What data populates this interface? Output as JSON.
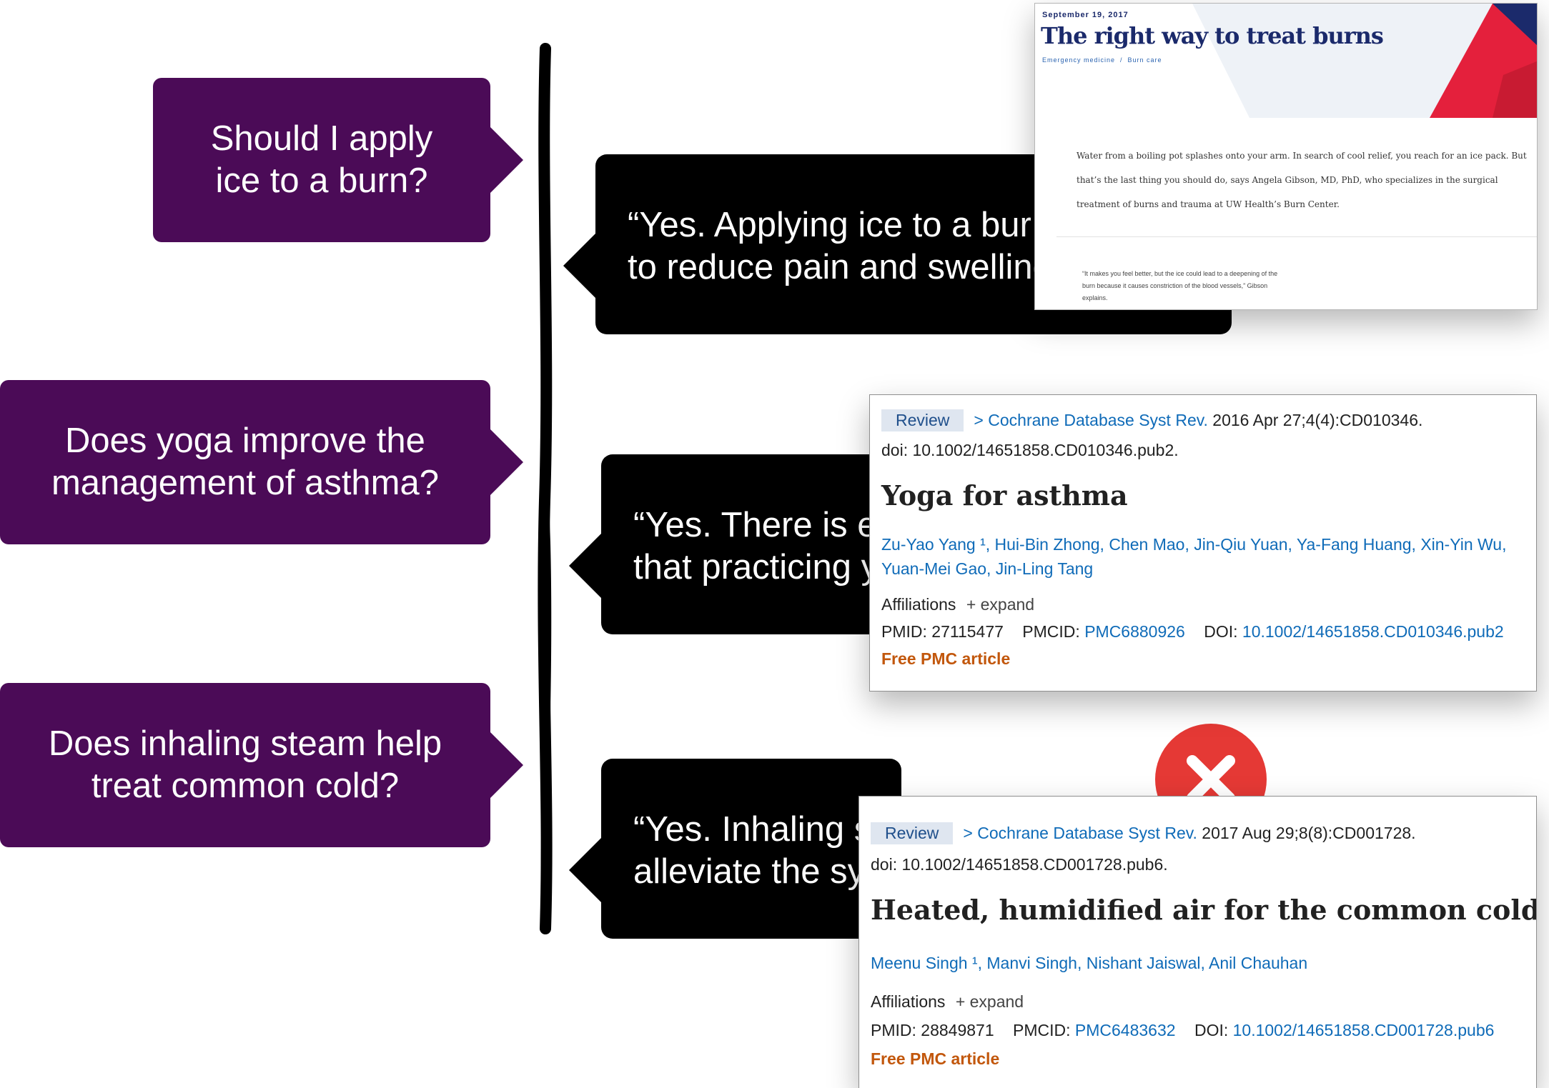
{
  "questions": [
    {
      "text": "Should I apply\nice to a burn?"
    },
    {
      "text": "Does yoga improve the\nmanagement of asthma?"
    },
    {
      "text": "Does inhaling steam help\ntreat common cold?"
    }
  ],
  "answers": [
    {
      "text": "“Yes. Applying ice to a bur\nto reduce pain and swelling"
    },
    {
      "text": "“Yes. There is e\nthat practicing y"
    },
    {
      "text": "“Yes. Inhaling s\nalleviate the sy"
    }
  ],
  "burn_article": {
    "date": "September 19, 2017",
    "title": "The right way to treat burns",
    "tags": "Emergency medicine  /  Burn care",
    "body_lines": [
      "Water from a boiling pot splashes onto your arm. In search of cool relief, you reach for an ice pack. But",
      "that’s the last thing you should do, says Angela Gibson, MD, PhD, who specializes in the surgical",
      "treatment of burns and trauma at UW Health’s Burn Center."
    ],
    "quote_lines": [
      "“It makes you feel better, but the ice could lead to a deepening of the",
      "burn because it causes constriction of the blood vessels,” Gibson",
      "explains."
    ]
  },
  "pubmed_cards": [
    {
      "tag": "Review",
      "journal": "Cochrane Database Syst Rev.",
      "citation": " 2016 Apr 27;4(4):CD010346.",
      "doi_line": "doi: 10.1002/14651858.CD010346.pub2.",
      "title": "Yoga for asthma",
      "authors_line1": "Zu-Yao Yang ¹, Hui-Bin Zhong, Chen Mao, Jin-Qiu Yuan, Ya-Fang Huang, Xin-Yin Wu,",
      "authors_line2": "Yuan-Mei Gao, Jin-Ling Tang",
      "affiliations": "Affiliations",
      "expand": "+ expand",
      "pmid_label": "PMID: ",
      "pmid": "27115477",
      "pmcid_label": "PMCID: ",
      "pmcid": "PMC6880926",
      "doi_label": "DOI: ",
      "doi": "10.1002/14651858.CD010346.pub2",
      "free": "Free PMC article"
    },
    {
      "tag": "Review",
      "journal": "Cochrane Database Syst Rev.",
      "citation": " 2017 Aug 29;8(8):CD001728.",
      "doi_line": "doi: 10.1002/14651858.CD001728.pub6.",
      "title": "Heated, humidified air for the common cold",
      "authors_line1": "Meenu Singh ¹, Manvi Singh, Nishant Jaiswal, Anil Chauhan",
      "affiliations": "Affiliations",
      "expand": "+ expand",
      "pmid_label": "PMID: ",
      "pmid": "28849871",
      "pmcid_label": "PMCID: ",
      "pmcid": "PMC6483632",
      "doi_label": "DOI: ",
      "doi": "10.1002/14651858.CD001728.pub6",
      "free": "Free PMC article"
    }
  ],
  "colors": {
    "question_bg": "#4b0b57",
    "answer_bg": "#000000",
    "link": "#0f6bb8",
    "free_article": "#c2570c",
    "cross": "#e53935"
  },
  "icons": {
    "wrong_answer": "cross-circle-icon"
  }
}
